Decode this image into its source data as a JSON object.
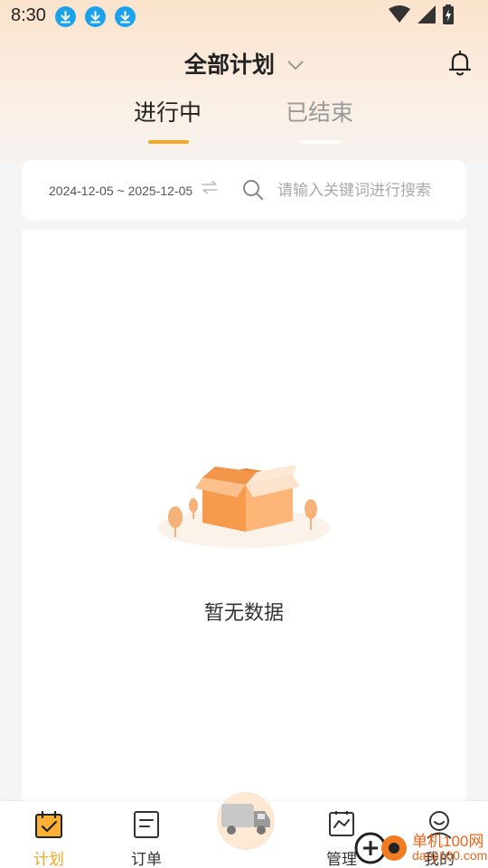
{
  "status_bar": {
    "time": "8:30"
  },
  "header": {
    "title": "全部计划"
  },
  "tabs": [
    {
      "label": "进行中",
      "active": true
    },
    {
      "label": "已结束",
      "active": false
    }
  ],
  "filter": {
    "date_range": "2024-12-05 ~ 2025-12-05",
    "search_placeholder": "请输入关键词进行搜索"
  },
  "empty_state": {
    "text": "暂无数据"
  },
  "bottom_nav": {
    "items": [
      {
        "label": "计划",
        "icon": "calendar-check-icon",
        "active": true
      },
      {
        "label": "订单",
        "icon": "document-icon",
        "active": false
      },
      {
        "label": "",
        "icon": "truck-icon",
        "active": false
      },
      {
        "label": "管理",
        "icon": "chart-board-icon",
        "active": false
      },
      {
        "label": "我的",
        "icon": "user-icon",
        "active": false
      }
    ]
  },
  "watermark": {
    "line1": "单机100网",
    "line2": "danji100.com"
  },
  "colors": {
    "accent": "#f5a623",
    "download_badge": "#1aa3ec",
    "box_orange": "#f7a25c"
  }
}
